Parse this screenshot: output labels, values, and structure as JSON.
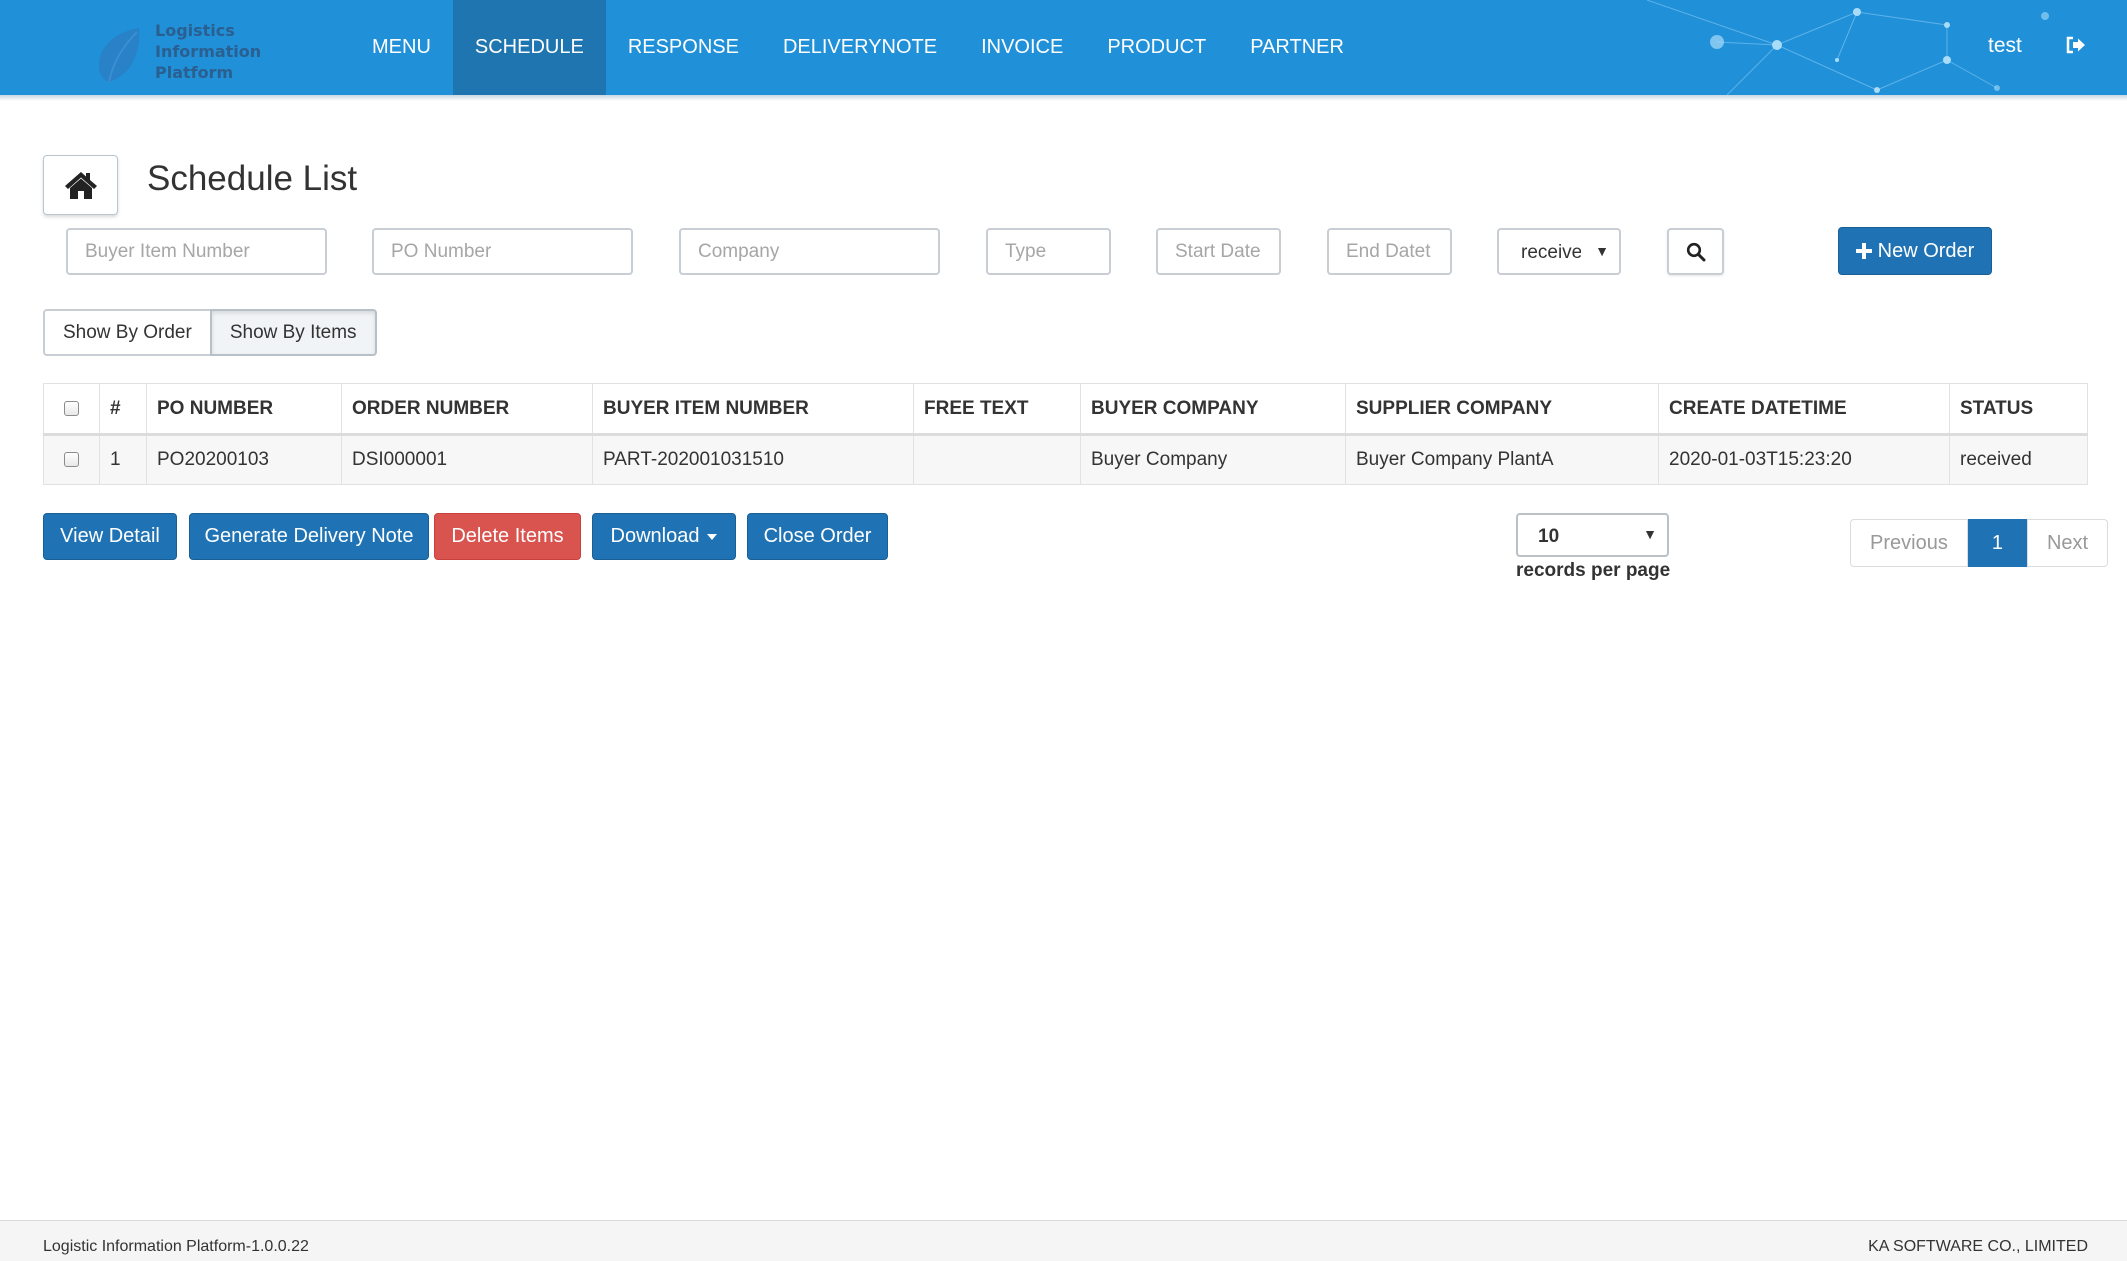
{
  "header": {
    "logo_lines": [
      "Logistics",
      "Information",
      "Platform"
    ],
    "nav": [
      {
        "label": "MENU",
        "active": false
      },
      {
        "label": "SCHEDULE",
        "active": true
      },
      {
        "label": "RESPONSE",
        "active": false
      },
      {
        "label": "DELIVERYNOTE",
        "active": false
      },
      {
        "label": "INVOICE",
        "active": false
      },
      {
        "label": "PRODUCT",
        "active": false
      },
      {
        "label": "PARTNER",
        "active": false
      }
    ],
    "user": "test",
    "logout_icon": "sign-out-icon",
    "bg_color": "#2090d9",
    "active_color": "#1f75b0"
  },
  "page": {
    "home_icon": "home-icon",
    "title": "Schedule List"
  },
  "filters": {
    "buyer_item_number_placeholder": "Buyer Item Number",
    "po_number_placeholder": "PO Number",
    "company_placeholder": "Company",
    "type_placeholder": "Type",
    "start_date_placeholder": "Start Date",
    "end_date_placeholder": "End Datet",
    "status_selected": "received",
    "search_icon": "search-icon",
    "new_order_label": "New Order"
  },
  "view_toggle": {
    "by_order": "Show By Order",
    "by_items": "Show By Items",
    "selected": "by_items"
  },
  "table": {
    "columns": [
      "#",
      "PO NUMBER",
      "ORDER NUMBER",
      "BUYER ITEM NUMBER",
      "FREE TEXT",
      "BUYER COMPANY",
      "SUPPLIER COMPANY",
      "CREATE DATETIME",
      "STATUS"
    ],
    "rows": [
      {
        "checked": false,
        "cells": [
          "1",
          "PO20200103",
          "DSI000001",
          "PART-202001031510",
          "",
          "Buyer Company",
          "Buyer Company PlantA",
          "2020-01-03T15:23:20",
          "received"
        ]
      }
    ]
  },
  "actions": {
    "view_detail": "View Detail",
    "generate_delivery_note": "Generate Delivery Note",
    "delete_items": "Delete Items",
    "download": "Download",
    "close_order": "Close Order"
  },
  "pagination": {
    "records_per_page_value": "10",
    "records_per_page_label": "records per page",
    "previous": "Previous",
    "current": "1",
    "next": "Next"
  },
  "footer": {
    "left": "Logistic Information Platform-1.0.0.22",
    "right": "KA SOFTWARE CO., LIMITED"
  },
  "colors": {
    "primary": "#1f73b4",
    "danger": "#d9534f"
  }
}
